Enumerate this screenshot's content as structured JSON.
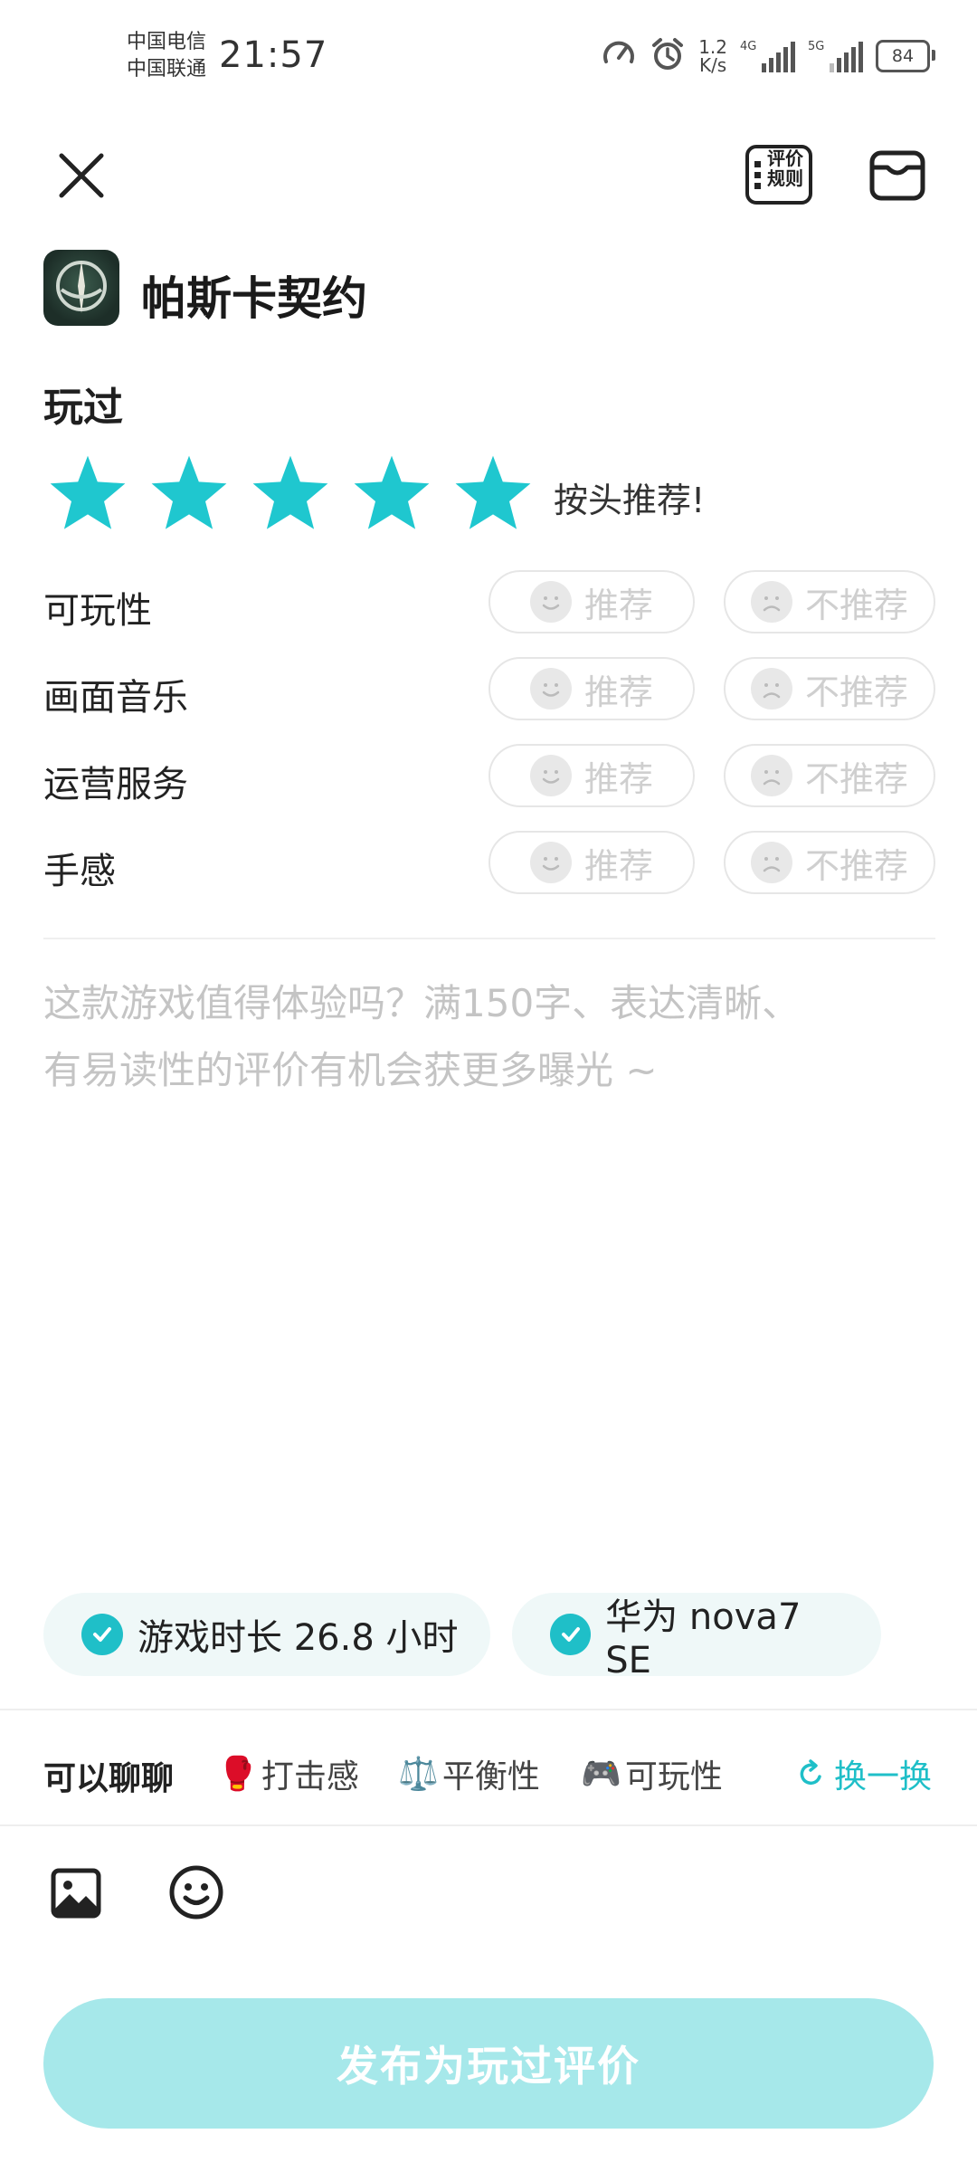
{
  "status_bar": {
    "carrier1": "中国电信",
    "carrier2": "中国联通",
    "time": "21:57",
    "net_speed_value": "1.2",
    "net_speed_unit": "K/s",
    "signal1_tag": "4G",
    "signal2_tag": "5G",
    "battery": "84"
  },
  "header": {
    "rules_label_line1": "评价",
    "rules_label_line2": "规则"
  },
  "game": {
    "title": "帕斯卡契约"
  },
  "rating": {
    "section_title": "玩过",
    "stars": 5,
    "star_color": "#1fc7cf",
    "label": "按头推荐!"
  },
  "aspects": [
    {
      "label": "可玩性",
      "recommend": "推荐",
      "not_recommend": "不推荐"
    },
    {
      "label": "画面音乐",
      "recommend": "推荐",
      "not_recommend": "不推荐"
    },
    {
      "label": "运营服务",
      "recommend": "推荐",
      "not_recommend": "不推荐"
    },
    {
      "label": "手感",
      "recommend": "推荐",
      "not_recommend": "不推荐"
    }
  ],
  "review": {
    "placeholder_line1": "这款游戏值得体验吗？满150字、表达清晰、",
    "placeholder_line2": "有易读性的评价有机会获更多曝光 ~"
  },
  "chips": {
    "playtime": "游戏时长 26.8 小时",
    "device": "华为 nova7 SE"
  },
  "topics": {
    "lead": "可以聊聊",
    "items": [
      {
        "emoji": "🥊",
        "label": "打击感"
      },
      {
        "emoji": "⚖️",
        "label": "平衡性"
      },
      {
        "emoji": "🎮",
        "label": "可玩性"
      }
    ],
    "swap": "换一换"
  },
  "colors": {
    "accent": "#1fbfc8",
    "submit_bg": "#a6e8ea"
  },
  "submit_label": "发布为玩过评价"
}
